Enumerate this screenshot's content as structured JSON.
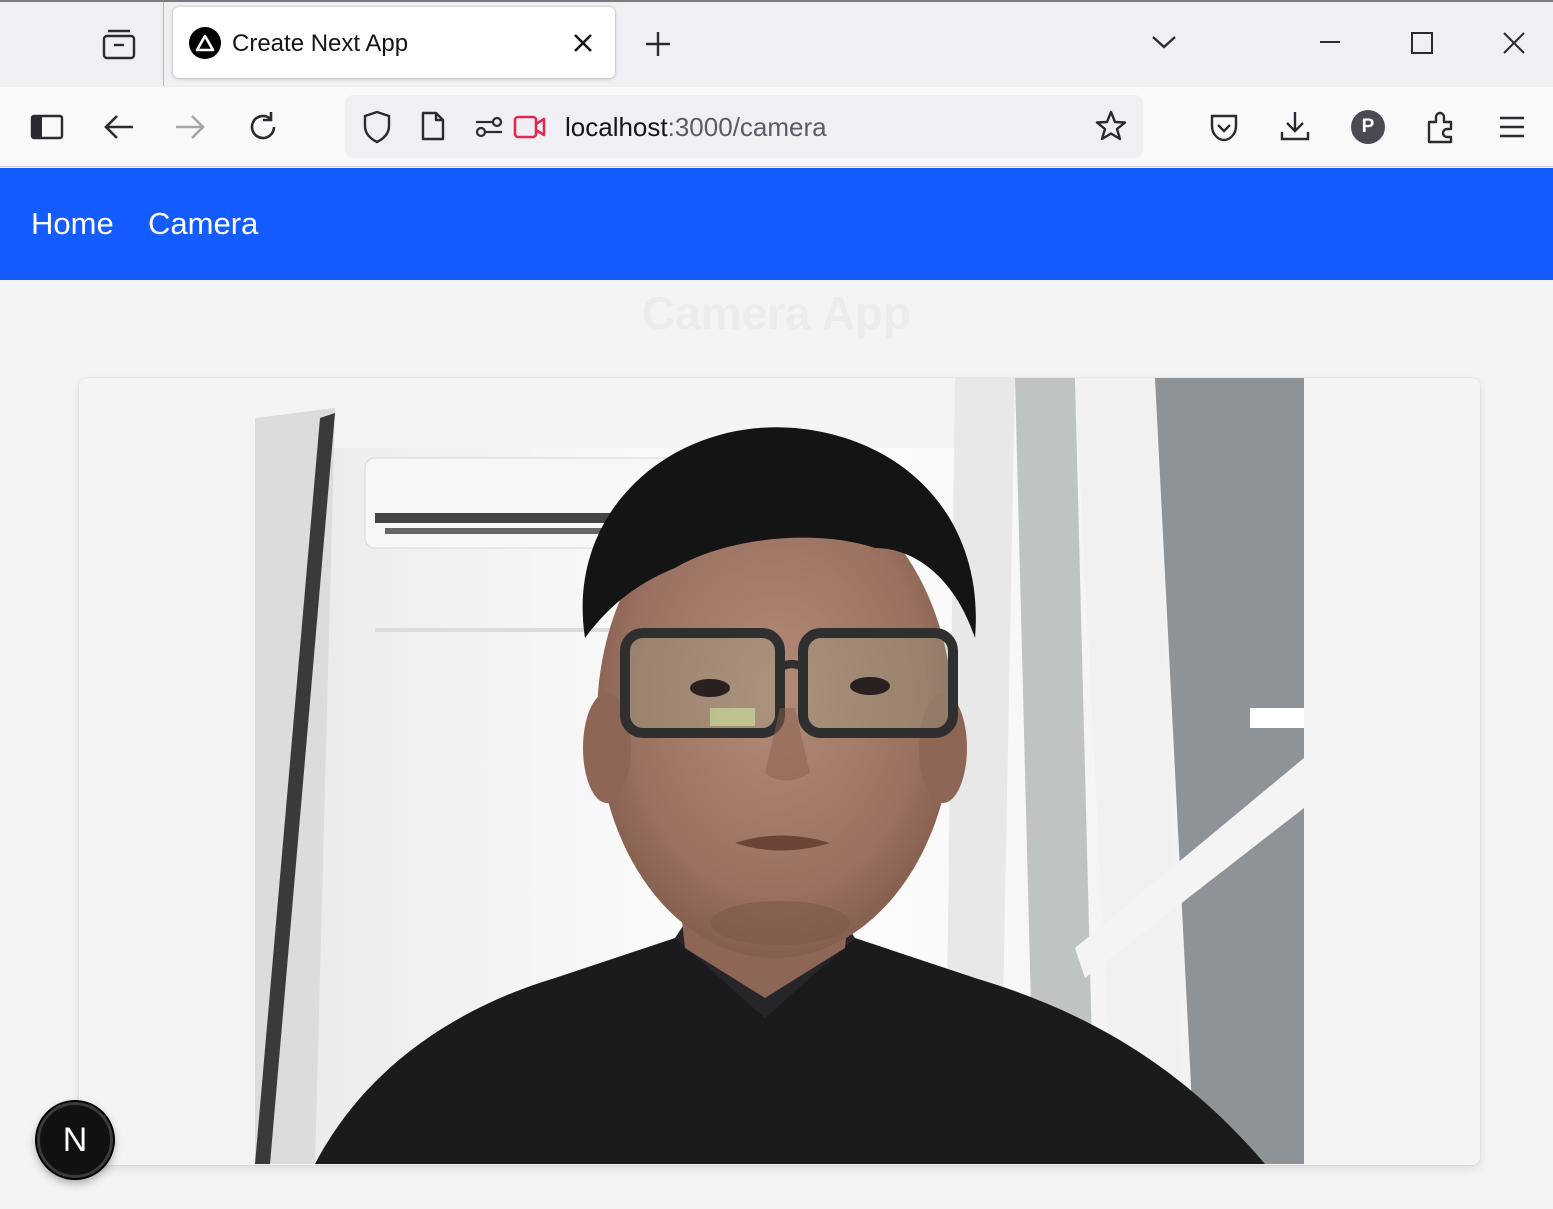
{
  "browser": {
    "tab": {
      "title": "Create Next App"
    },
    "url": {
      "host": "localhost",
      "path": ":3000/camera"
    },
    "profile_initial": "P",
    "icons": [
      "tab-overview-icon",
      "new-tab-icon",
      "list-tabs-icon",
      "minimize-icon",
      "maximize-icon",
      "close-window-icon",
      "sidebar-icon",
      "back-icon",
      "forward-icon",
      "reload-icon",
      "shield-icon",
      "page-icon",
      "permissions-icon",
      "camera-in-use-icon",
      "bookmark-star-icon",
      "pocket-icon",
      "download-icon",
      "extensions-icon",
      "menu-icon"
    ]
  },
  "nav": {
    "links": [
      "Home",
      "Camera"
    ]
  },
  "page": {
    "title": "Camera App"
  },
  "next_badge": {
    "label": "N"
  },
  "colors": {
    "nav_bg": "#145cff",
    "page_bg": "#f3f4f6",
    "camera_indicator": "#e22850"
  }
}
